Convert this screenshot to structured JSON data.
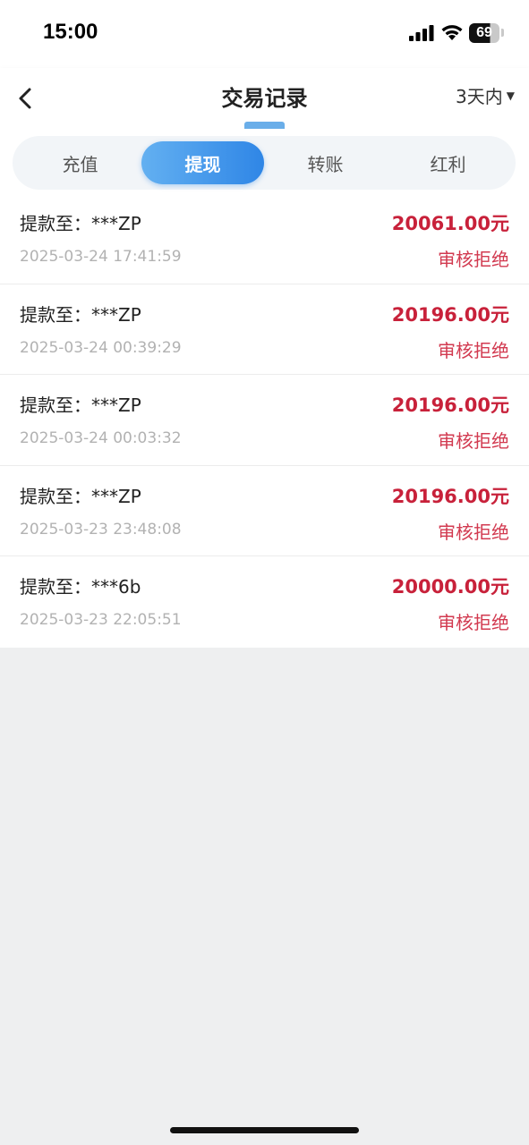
{
  "status_bar": {
    "time": "15:00",
    "battery": "69",
    "icons": [
      "signal-icon",
      "wifi-icon",
      "battery-icon"
    ]
  },
  "nav": {
    "back_icon": "chevron-left-icon",
    "title": "交易记录",
    "range_label": "3天内",
    "range_icon": "caret-down-icon"
  },
  "tabs": [
    {
      "label": "充值",
      "active": false
    },
    {
      "label": "提现",
      "active": true
    },
    {
      "label": "转账",
      "active": false
    },
    {
      "label": "红利",
      "active": false
    }
  ],
  "records": [
    {
      "dest": "提款至：***ZP",
      "amount": "20061.00元",
      "time": "2025-03-24 17:41:59",
      "status": "审核拒绝"
    },
    {
      "dest": "提款至：***ZP",
      "amount": "20196.00元",
      "time": "2025-03-24 00:39:29",
      "status": "审核拒绝"
    },
    {
      "dest": "提款至：***ZP",
      "amount": "20196.00元",
      "time": "2025-03-24 00:03:32",
      "status": "审核拒绝"
    },
    {
      "dest": "提款至：***ZP",
      "amount": "20196.00元",
      "time": "2025-03-23 23:48:08",
      "status": "审核拒绝"
    },
    {
      "dest": "提款至：***6b",
      "amount": "20000.00元",
      "time": "2025-03-23 22:05:51",
      "status": "审核拒绝"
    }
  ],
  "colors": {
    "accent": "#2f86e6",
    "amount": "#c8213a",
    "status_rejected": "#d23a50",
    "background": "#eeeff0"
  }
}
